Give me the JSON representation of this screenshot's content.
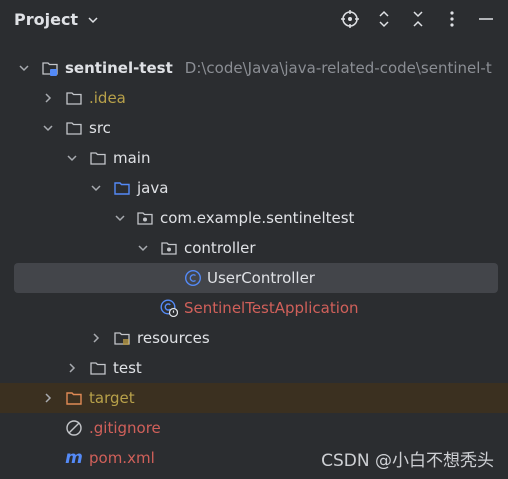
{
  "panel": {
    "title": "Project"
  },
  "toolbar": {
    "locate_icon": "crosshair-icon",
    "expand_icon": "expand-all-icon",
    "collapse_icon": "collapse-all-icon",
    "options_icon": "more-vertical-icon",
    "hide_icon": "minimize-icon"
  },
  "tree": {
    "root": {
      "label": "sentinel-test",
      "path": "D:\\code\\Java\\java-related-code\\sentinel-t"
    },
    "idea": {
      "label": ".idea"
    },
    "src": {
      "label": "src"
    },
    "main": {
      "label": "main"
    },
    "java": {
      "label": "java"
    },
    "package": {
      "label": "com.example.sentineltest"
    },
    "controller": {
      "label": "controller"
    },
    "user_controller": {
      "label": "UserController"
    },
    "app": {
      "label": "SentinelTestApplication"
    },
    "resources": {
      "label": "resources"
    },
    "test": {
      "label": "test"
    },
    "target": {
      "label": "target"
    },
    "gitignore": {
      "label": ".gitignore"
    },
    "pom": {
      "label": "pom.xml"
    }
  },
  "watermark": "CSDN @小白不想秃头",
  "colors": {
    "background": "#2b2d30",
    "selected_row": "#43454a",
    "excluded_row": "#3b3020",
    "excluded_text": "#b8a14a",
    "error_text": "#d0605a",
    "folder_blue": "#548af7"
  }
}
